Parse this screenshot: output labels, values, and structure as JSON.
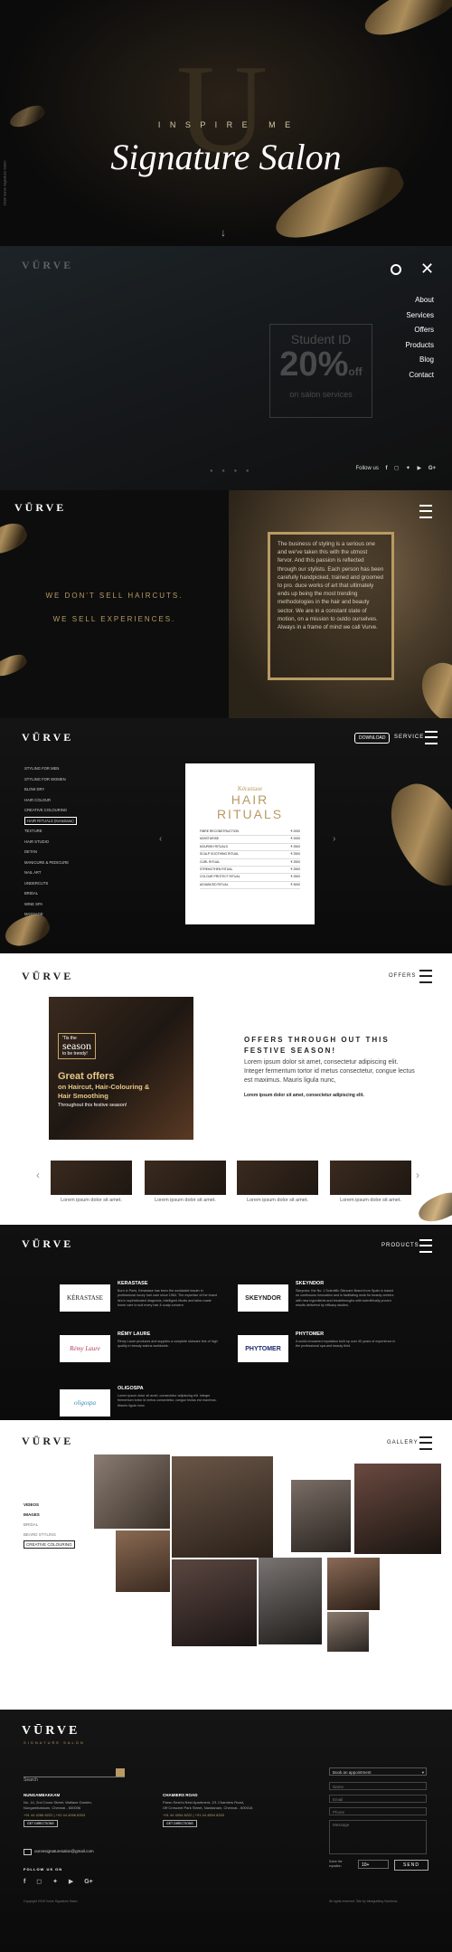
{
  "hero": {
    "inspire": "I N S P I R E   M E",
    "script_title": "Signature Salon",
    "side_text": "2018 Vurve Signature Salon",
    "big_letter": "U",
    "scroll_arrow": "↓"
  },
  "menu": {
    "logo": "VŪRVE",
    "items": [
      "About",
      "Services",
      "Offers",
      "Products",
      "Blog",
      "Contact"
    ],
    "follow": "Follow us",
    "promo": {
      "title": "Student ID",
      "percent": "20%",
      "off": "off",
      "sub": "on salon services"
    }
  },
  "about": {
    "logo": "VŪRVE",
    "tagline1": "WE DON'T SELL HAIRCUTS.",
    "tagline2": "WE SELL EXPERIENCES.",
    "text": "The business of styling is a serious one and we've taken this with the utmost fervor. And this passion is reflected through our stylists. Each person has been carefully handpicked, trained and groomed to pro. duce works of art that ultimately ends up being the most trending methodologies in the hair and beauty sector. We are in a constant state of motion, on a mission to outdo ourselves. Always in a frame of mind we call Vurve."
  },
  "services": {
    "logo": "VŪRVE",
    "download": "DOWNLOAD",
    "label": "SERVICE",
    "list": [
      "STYLING FOR MEN",
      "STYLING FOR WOMEN",
      "BLOW DRY",
      "HAIR COLOUR",
      "CREATIVE COLOURING",
      "HAIR RITUALS (Kerastase)",
      "TEXTURE",
      "HAIR STUDIO",
      "DETAN",
      "MANICURE & PEDICURE",
      "NAIL ART",
      "UNDERCUTS",
      "BRIDAL",
      "WINE SPA",
      "MASSAGE"
    ],
    "card": {
      "brand": "Kérastase",
      "title1": "HAIR",
      "title2": "RITUALS",
      "rows": [
        [
          "FIBRE RECONSTRUCTION",
          "₹ 2000"
        ],
        [
          "MOISTURISE",
          "₹ 2000"
        ],
        [
          "NOURISH RITUALS",
          "₹ 2500"
        ],
        [
          "SCALP SOOTHING RITUAL",
          "₹ 2500"
        ],
        [
          "CURL RITUAL",
          "₹ 2500"
        ],
        [
          "STRENGTHEN RITUAL",
          "₹ 2500"
        ],
        [
          "COLOUR PROTECT RITUAL",
          "₹ 2500"
        ],
        [
          "ADVANCED RITUAL",
          "₹ 3000"
        ]
      ]
    }
  },
  "offers": {
    "logo": "VŪRVE",
    "label": "OFFERS",
    "banner": {
      "small1": "'Tis the",
      "season": "season",
      "small2": "to be trendy!",
      "great": "Great offers",
      "line2": "on Haircut, Hair-Colouring &",
      "line3": "Hair Smoothing",
      "line4": "Throughout this festive season!"
    },
    "heading": "OFFERS THROUGH OUT THIS FESTIVE SEASON!",
    "lorem": "Lorem ipsum dolor sit amet, consectetur adipiscing elit. Integer fermentum tortor id metus consectetur, congue lectus est maximus. Mauris ligula nunc,",
    "bold": "Lorem ipsum dolor sit amet, consectetur adipiscing elit.",
    "thumb_caption": "Lorem ipsum dolor sit amet."
  },
  "products": {
    "logo": "VŪRVE",
    "label": "PRODUCTS",
    "items": [
      {
        "name": "KERASTASE",
        "logo": "KÉRASTASE",
        "desc": "Born in Paris, Kérastase has been the worldwide leader in professional luxury hair care since 1964. The expertise of the brand lies in sophisticated diagnosis, intelligent rituals and tailor-made home care to suit every hair & scalp concern."
      },
      {
        "name": "SKEYNDOR",
        "logo": "SKEYNDOR",
        "desc": "Skeyndor, the No. 1 Scientific Skincare Brand from Spain is based on continuous innovation and is facilitating work for beauty centers with new ingredients and breakthroughs with scientifically proven results delivered by efficacy studies."
      },
      {
        "name": "RÉMY LAURE",
        "logo": "Rémy Laure",
        "desc": "Rémy Laure produces and supplies a complete skincare line of high quality in beauty salons worldwide."
      },
      {
        "name": "PHYTOMER",
        "logo": "PHYTOMER",
        "desc": "A world-renowned reputation built up over 40 years of experience in the professional spa and beauty field."
      },
      {
        "name": "OLIGOSPA",
        "logo": "oligospa",
        "desc": "Lorem ipsum dolor sit amet, consectetur adipiscing elit. Integer fermentum tortor id metus consectetur, congue lectus est maximus. Mauris ligula nunc."
      }
    ]
  },
  "gallery": {
    "logo": "VŪRVE",
    "label": "GALLERY",
    "nav": [
      "VIDEOS",
      "IMAGES",
      "BRIDAL",
      "BEARD STYLING",
      "CREATIVE COLOURING"
    ]
  },
  "footer": {
    "logo": "VŪRVE",
    "sub": "SIGNATURE SALON",
    "search": "Search",
    "addr1": {
      "title": "NUNGAMBAKKAM",
      "line1": "No. 14, 2nd Cross Street, Wallace Garden,",
      "line2": "Nungambakkam, Chennai - 600006",
      "phone": "+91 44 4266 8222 | +91 44 4266 8333",
      "btn": "GET DIRECTIONS"
    },
    "addr2": {
      "title": "CHAMIERS ROAD",
      "line1": "Parsn Sesh's Nest Apartment, 2/1 Chamiers Road,",
      "line2": "Off Crescent Park Street, Nandanam, Chennai - 600018",
      "phone": "+91 44 4554 8222 | +91 44 4554 8333",
      "btn": "GET DIRECTIONS"
    },
    "book": "Book an appointment",
    "field1": "Name",
    "field2": "Email",
    "field3": "Phone",
    "message": "Message",
    "solve_label": "Solve the equation",
    "captcha": "10+",
    "send": "SEND",
    "email": "ourvesignaturesalon@gmail.com",
    "follow": "FOLLOW US ON",
    "copyright": "Copyright 2018 Vurve Signature Salon",
    "rights": "All rights reserved. Site by Ideagrafting Solutions"
  },
  "colors": {
    "gold": "#b89a63",
    "dark": "#0c0c0c"
  }
}
